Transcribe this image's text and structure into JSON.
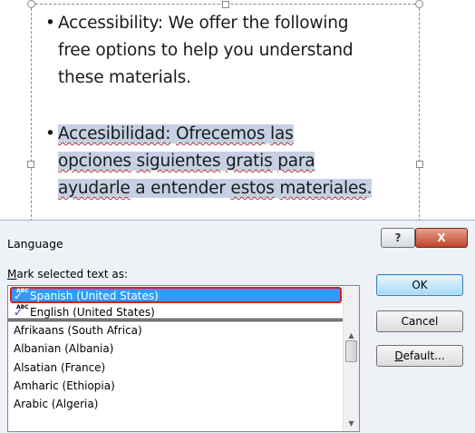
{
  "document": {
    "paragraph_en": {
      "bullet": "•",
      "lines": [
        "Accessibility:  We offer the following",
        "free options to help you understand",
        "these materials."
      ]
    },
    "paragraph_es": {
      "bullet": "•",
      "lines": [
        [
          "Accesibilidad:",
          " ",
          "Ofrecemos",
          " ",
          "las"
        ],
        [
          "opciones",
          " ",
          "siguientes",
          "  ",
          "gratis",
          " ",
          "para"
        ],
        [
          "ayudarle",
          " a entender  ",
          "estos",
          " ",
          "materiales",
          "."
        ]
      ]
    }
  },
  "dialog": {
    "title": "Language",
    "help_glyph": "?",
    "close_glyph": "X",
    "mark_label": "Mark selected text as:",
    "languages": [
      {
        "label": "Spanish (United States)",
        "proofing": true,
        "selected": true
      },
      {
        "label": "English (United States)",
        "proofing": true,
        "selected": false
      },
      {
        "label": "Afrikaans (South Africa)",
        "proofing": false,
        "selected": false
      },
      {
        "label": "Albanian (Albania)",
        "proofing": false,
        "selected": false
      },
      {
        "label": "Alsatian (France)",
        "proofing": false,
        "selected": false
      },
      {
        "label": "Amharic (Ethiopia)",
        "proofing": false,
        "selected": false
      },
      {
        "label": "Arabic (Algeria)",
        "proofing": false,
        "selected": false
      }
    ],
    "abc_text": "ABC",
    "check_glyph": "✓",
    "scroll_up_glyph": "▲",
    "scroll_down_glyph": "▼",
    "ok_label": "OK",
    "cancel_label": "Cancel",
    "default_label": "Default..."
  }
}
